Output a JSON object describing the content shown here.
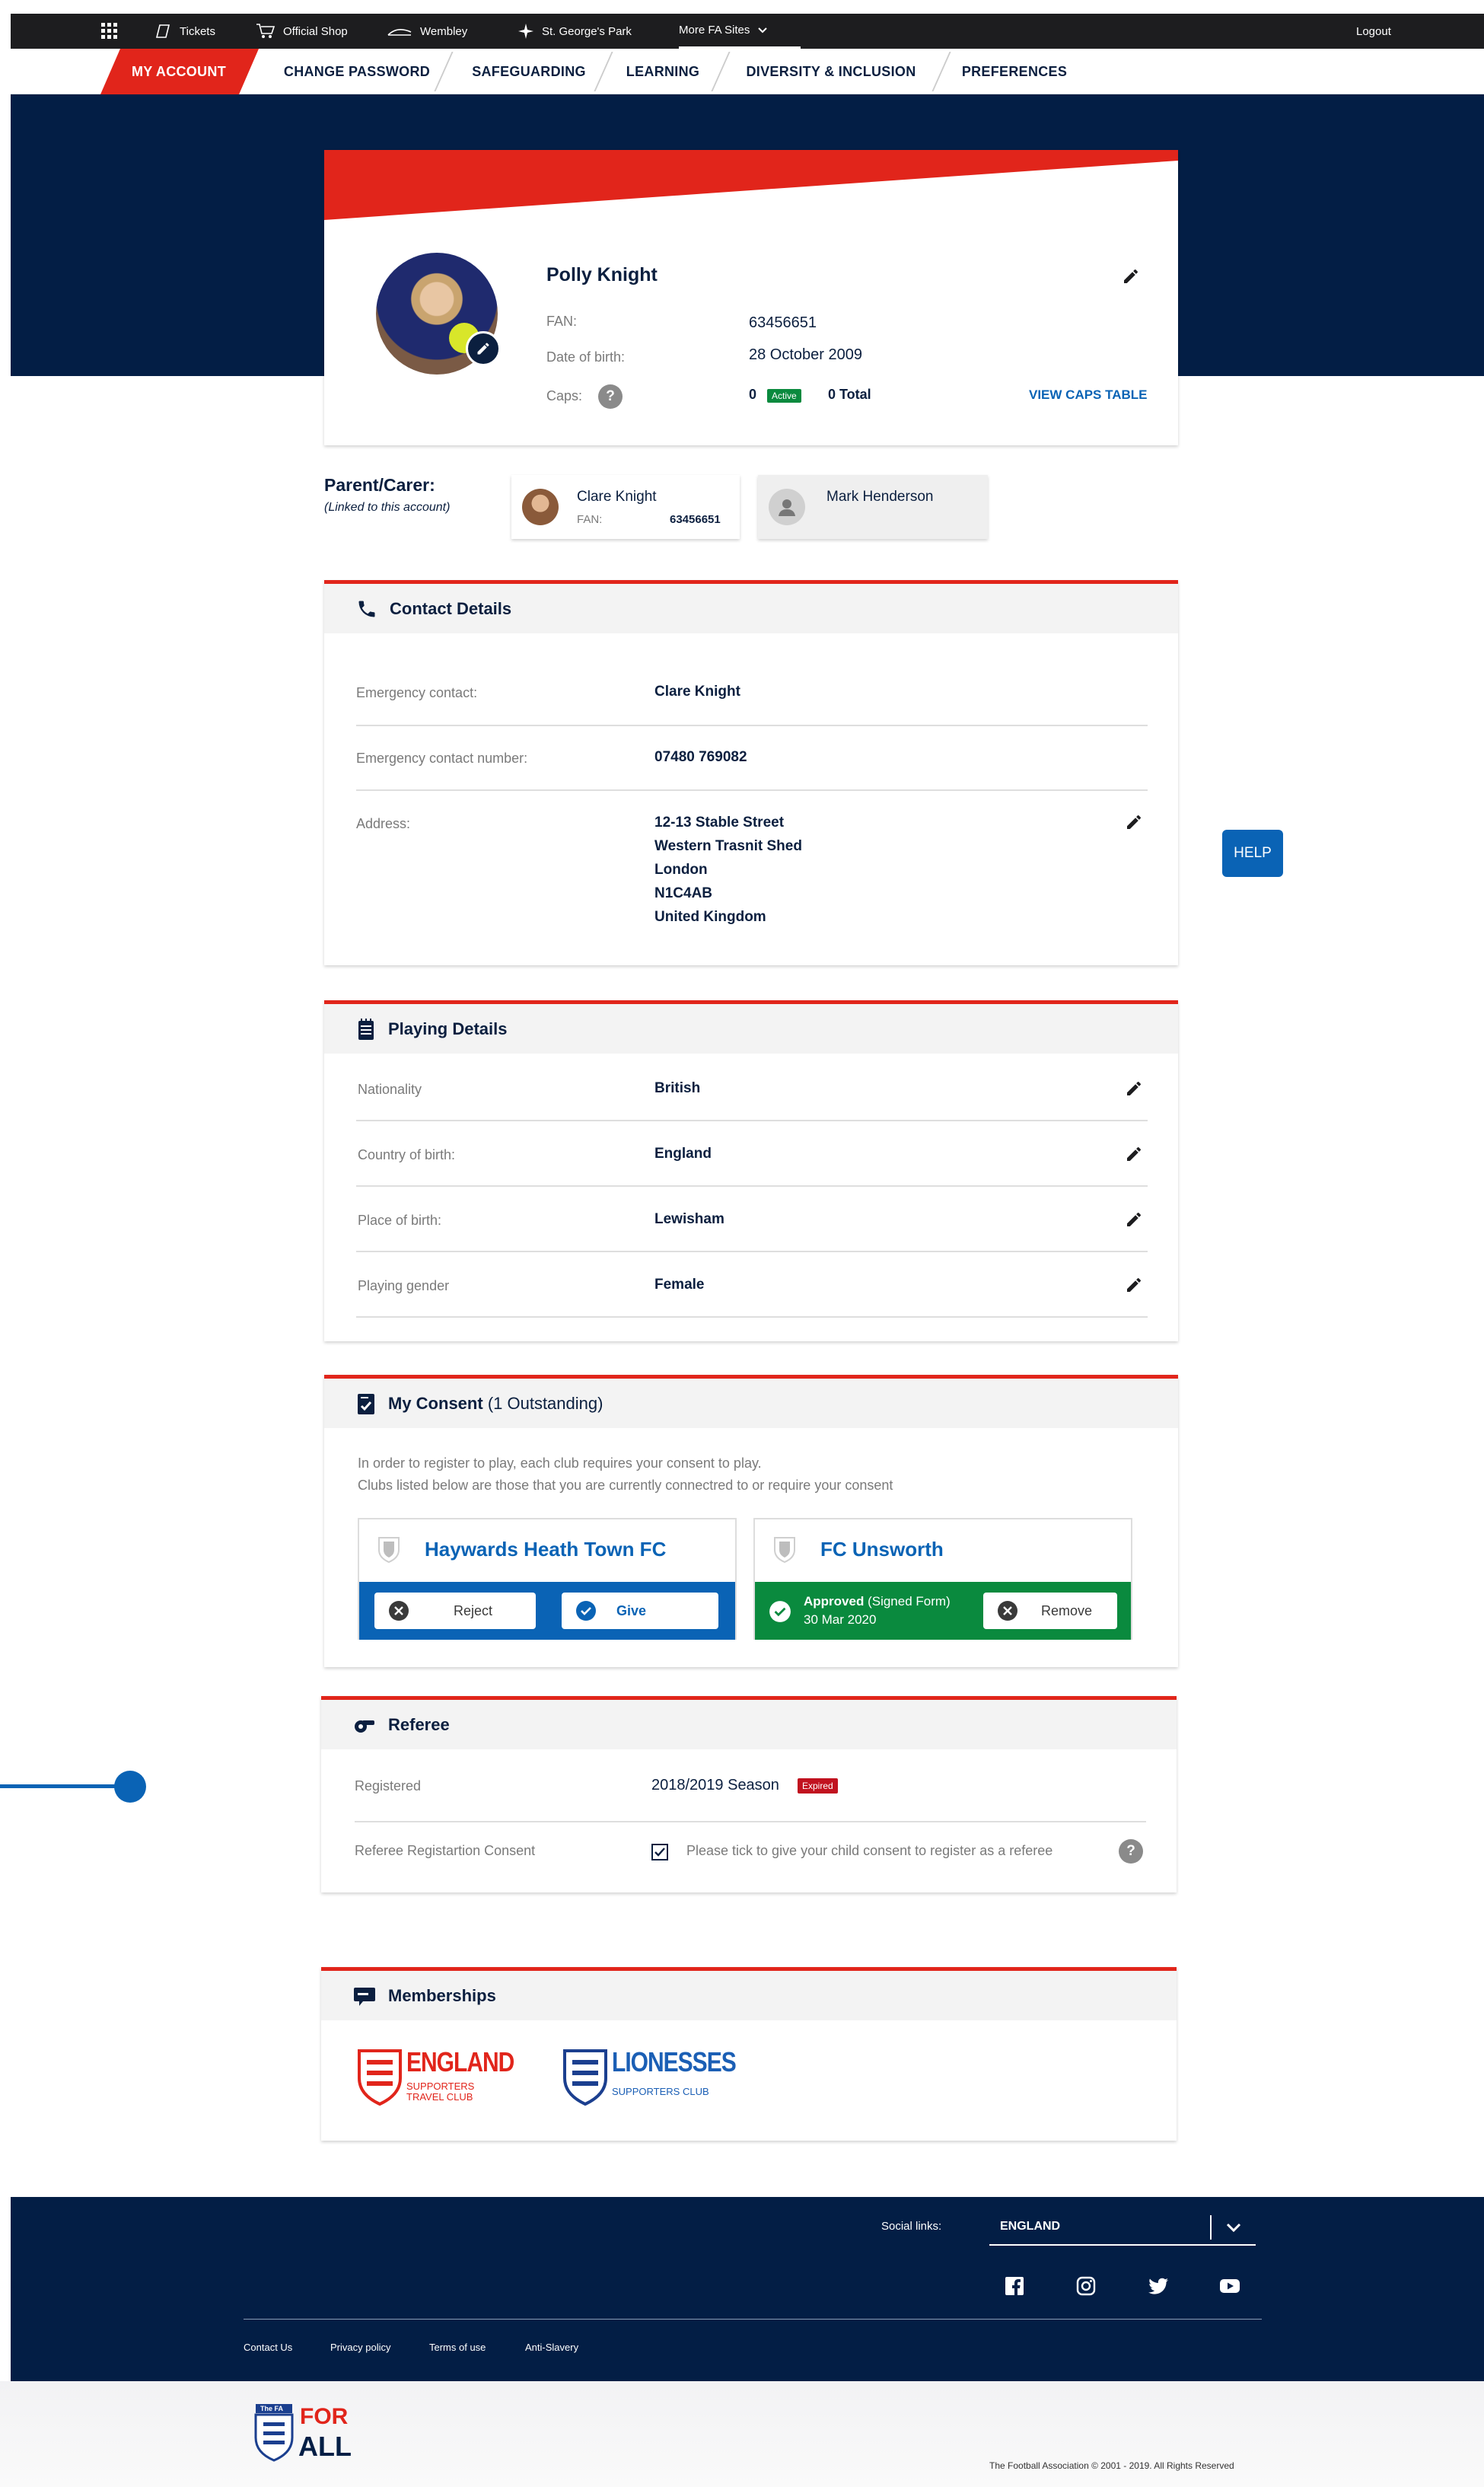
{
  "topbar": {
    "tickets": "Tickets",
    "shop": "Official Shop",
    "wembley": "Wembley",
    "sgp": "St. George's Park",
    "more": "More FA Sites",
    "logout": "Logout"
  },
  "nav": {
    "my_account": "MY ACCOUNT",
    "change_password": "CHANGE PASSWORD",
    "safeguarding": "SAFEGUARDING",
    "learning": "LEARNING",
    "diversity": "DIVERSITY & INCLUSION",
    "preferences": "PREFERENCES"
  },
  "profile": {
    "name": "Polly Knight",
    "fan_label": "FAN:",
    "fan_value": "63456651",
    "dob_label": "Date of birth:",
    "dob_value": "28 October 2009",
    "caps_label": "Caps:",
    "caps_active": "0",
    "active_badge": "Active",
    "caps_total": "0 Total",
    "view_caps": "VIEW CAPS TABLE"
  },
  "parents": {
    "title": "Parent/Carer:",
    "subtitle": "(Linked to this account)",
    "p1_name": "Clare Knight",
    "p1_fan_label": "FAN:",
    "p1_fan": "63456651",
    "p2_name": "Mark Henderson"
  },
  "contact": {
    "title": "Contact Details",
    "emergency_label": "Emergency contact:",
    "emergency_value": "Clare Knight",
    "number_label": "Emergency contact number:",
    "number_value": "07480 769082",
    "address_label": "Address:",
    "address_lines": [
      "12-13 Stable Street",
      "Western Trasnit Shed",
      "London",
      "N1C4AB",
      "United Kingdom"
    ]
  },
  "playing": {
    "title": "Playing Details",
    "rows": [
      {
        "label": "Nationality",
        "value": "British"
      },
      {
        "label": "Country of birth:",
        "value": "England"
      },
      {
        "label": "Place of birth:",
        "value": "Lewisham"
      },
      {
        "label": "Playing gender",
        "value": "Female"
      }
    ]
  },
  "consent": {
    "title": "My Consent",
    "outstanding": "(1 Outstanding)",
    "line1": "In order to register to play, each club requires your consent to play.",
    "line2": "Clubs listed below are those that you are currently connectred to or require your consent",
    "club1": "Haywards Heath Town FC",
    "reject": "Reject",
    "give": "Give",
    "club2": "FC Unsworth",
    "approved": "Approved",
    "signed": "(Signed Form)",
    "approved_date": "30 Mar 2020",
    "remove": "Remove"
  },
  "referee": {
    "title": "Referee",
    "registered_label": "Registered",
    "season": "2018/2019 Season",
    "expired": "Expired",
    "consent_label": "Referee Registartion Consent",
    "consent_text": "Please tick to give your child consent to register as a referee"
  },
  "memberships": {
    "title": "Memberships",
    "m1_big": "ENGLAND",
    "m1_small1": "SUPPORTERS",
    "m1_small2": "TRAVEL CLUB",
    "m2_big": "LIONESSES",
    "m2_small": "SUPPORTERS CLUB"
  },
  "help": "HELP",
  "footer": {
    "social_label": "Social links:",
    "country": "ENGLAND",
    "links": [
      "Contact Us",
      "Privacy policy",
      "Terms of use",
      "Anti-Slavery"
    ],
    "copyright": "The Football Association © 2001 - 2019. All Rights Reserved",
    "logo_top": "The FA",
    "logo_for": "FOR",
    "logo_all": "ALL"
  },
  "colors": {
    "navy": "#031e45",
    "red": "#e1251b",
    "blue": "#0a63b5",
    "green": "#0a8a3e"
  }
}
